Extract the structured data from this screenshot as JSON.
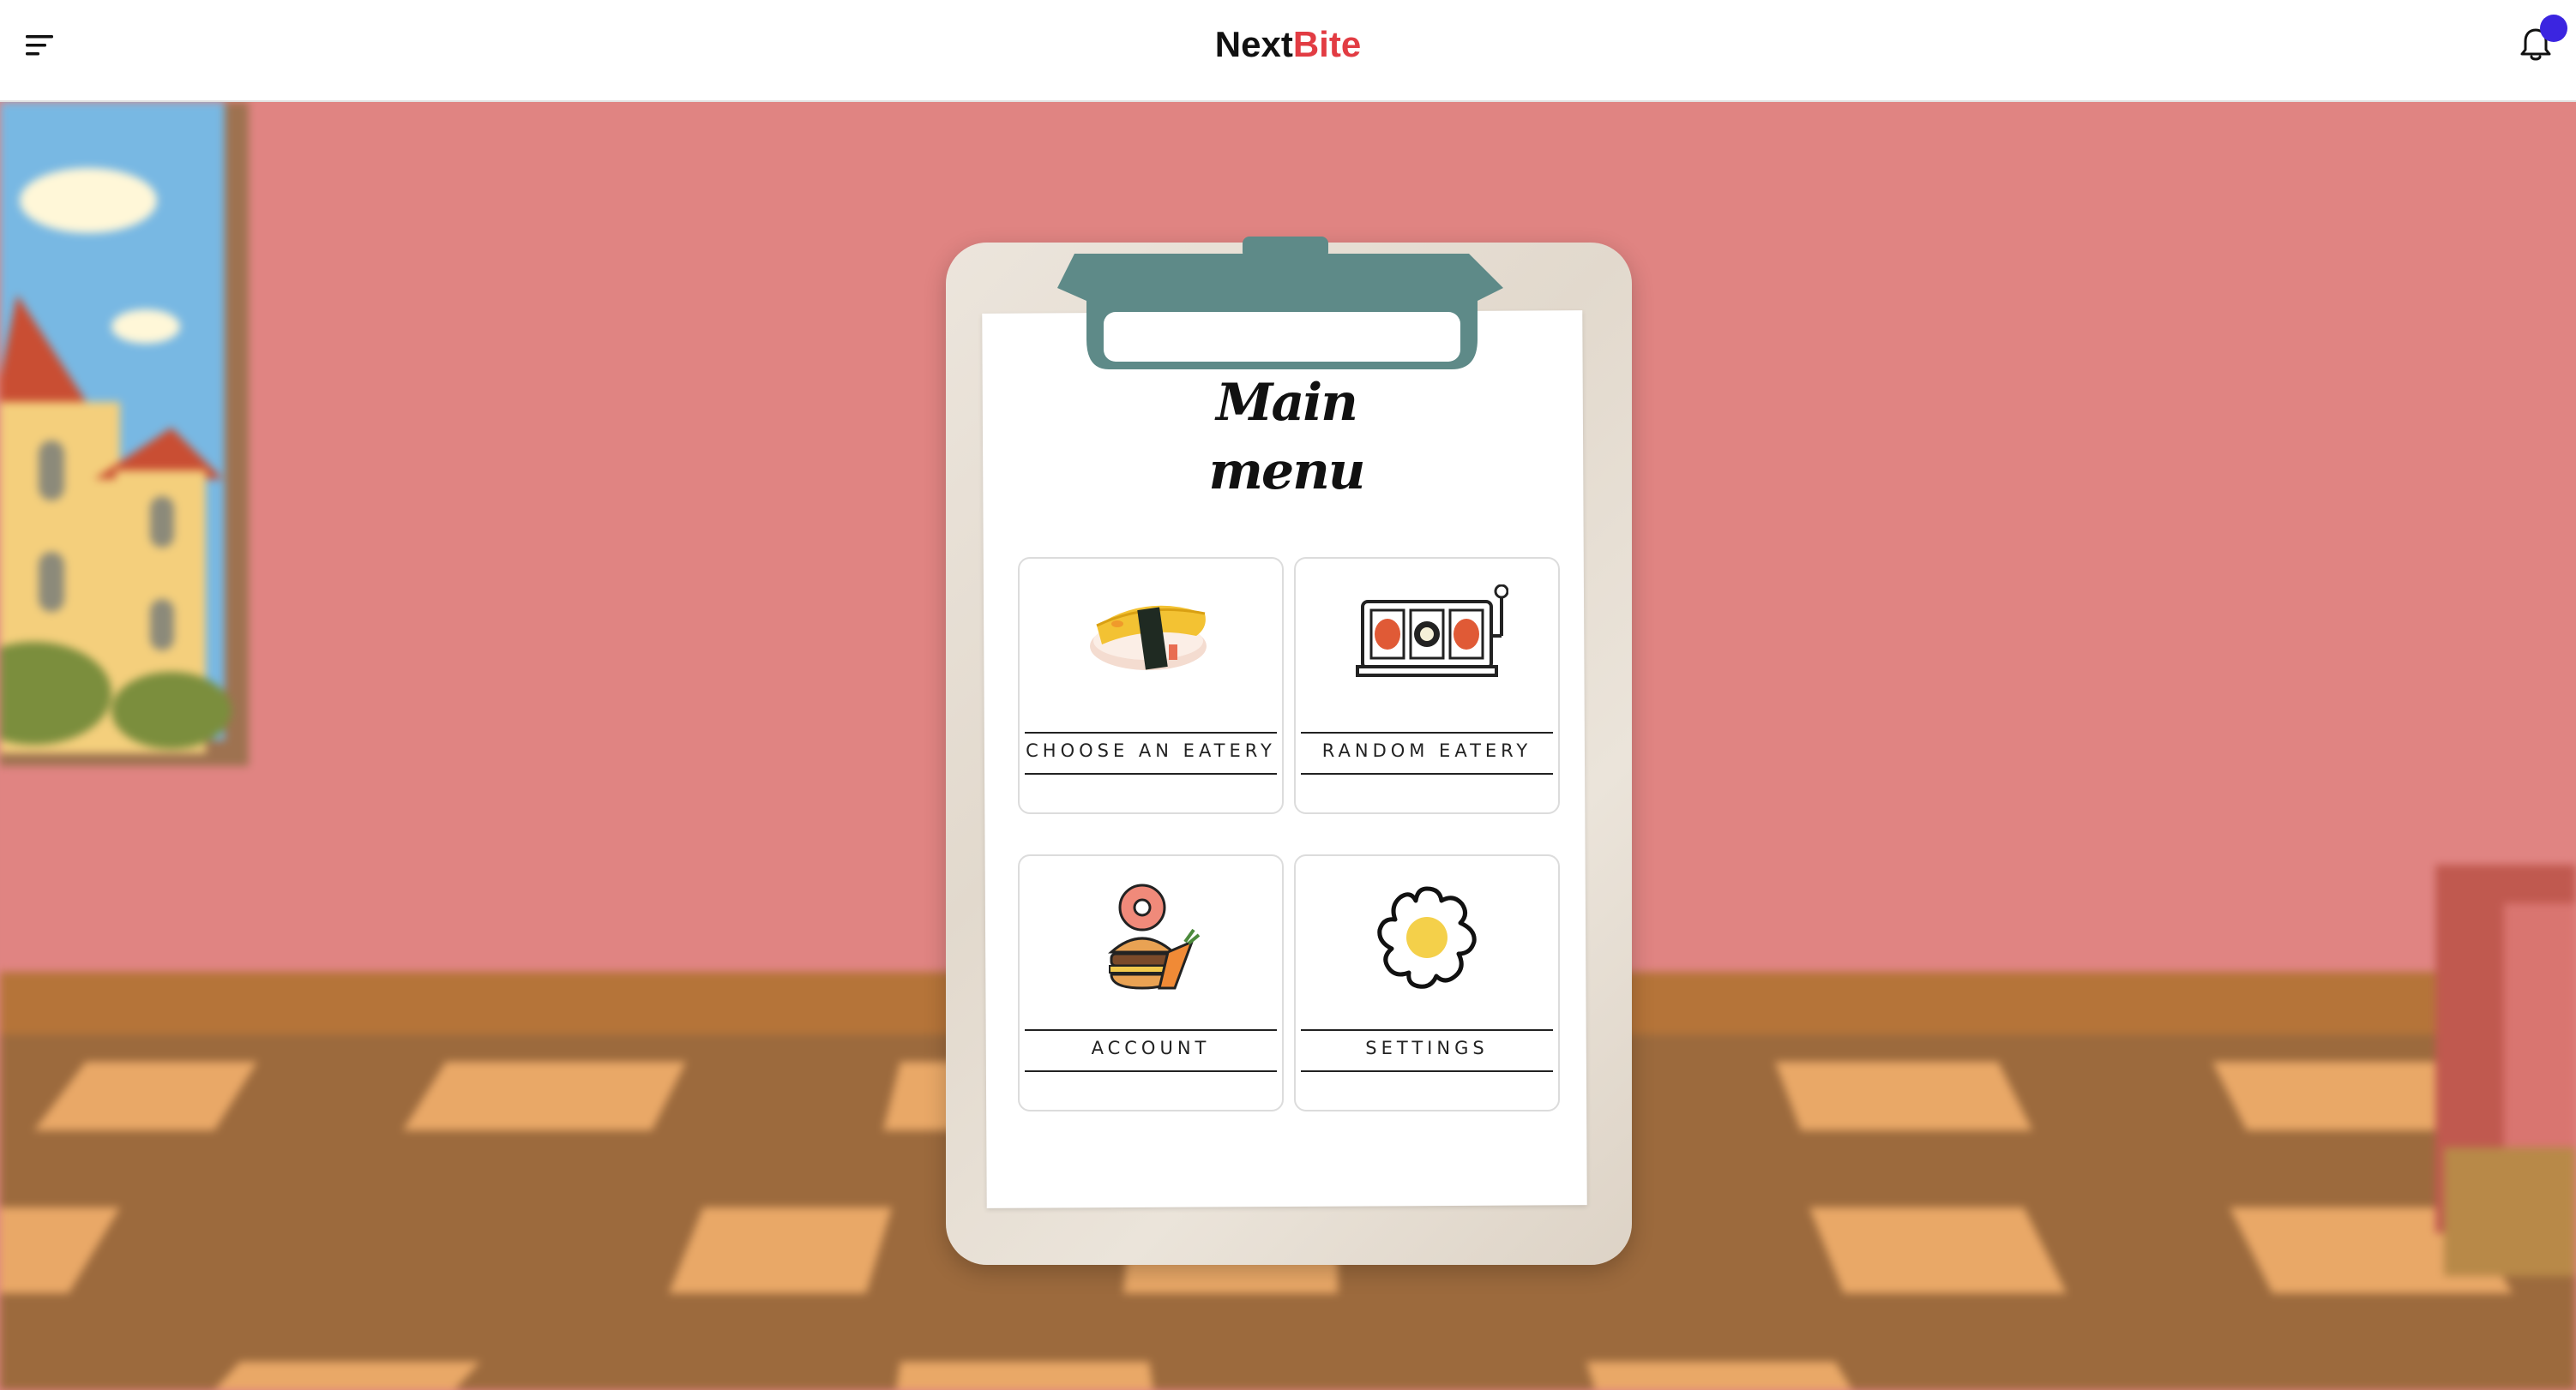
{
  "app": {
    "brand_part1": "Next",
    "brand_part2": "Bite",
    "brand_color_primary": "#111111",
    "brand_color_accent": "#e23c43",
    "notification_dot_color": "#3b25e0"
  },
  "icons": {
    "menu": "hamburger-menu-icon",
    "notifications": "bell-icon"
  },
  "board": {
    "title_line1": "Main",
    "title_line2": "menu"
  },
  "menu_items": [
    {
      "label": "CHOOSE AN EATERY",
      "icon": "sushi-icon"
    },
    {
      "label": "RANDOM EATERY",
      "icon": "slot-machine-icon"
    },
    {
      "label": "ACCOUNT",
      "icon": "food-stack-icon"
    },
    {
      "label": "SETTINGS",
      "icon": "egg-gear-icon"
    }
  ],
  "colors": {
    "wall": "#e08482",
    "floor_light": "#e9a867",
    "floor_dark": "#9c6a3d",
    "clip": "#5e8a88"
  }
}
